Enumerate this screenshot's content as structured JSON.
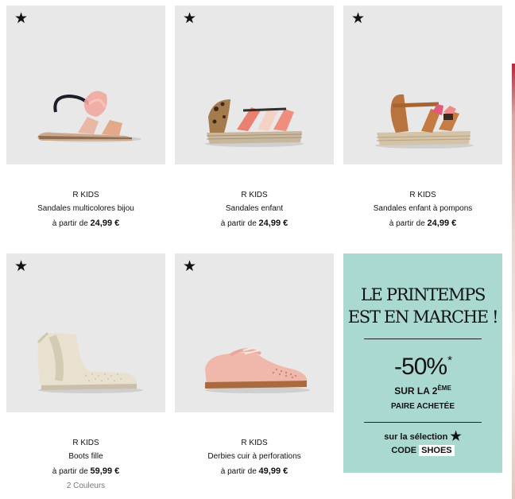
{
  "products": [
    {
      "brand": "R KIDS",
      "name": "Sandales multicolores bijou",
      "price_prefix": "à partir de",
      "price": "24,99 €",
      "fav_icon": "★"
    },
    {
      "brand": "R KIDS",
      "name": "Sandales enfant",
      "price_prefix": "à partir de",
      "price": "24,99 €",
      "fav_icon": "★"
    },
    {
      "brand": "R KIDS",
      "name": "Sandales enfant à pompons",
      "price_prefix": "à partir de",
      "price": "24,99 €",
      "fav_icon": "★"
    },
    {
      "brand": "R KIDS",
      "name": "Boots fille",
      "price_prefix": "à partir de",
      "price": "59,99 €",
      "colors": "2 Couleurs",
      "fav_icon": "★"
    },
    {
      "brand": "R KIDS",
      "name": "Derbies cuir à perforations",
      "price_prefix": "à partir de",
      "price": "49,99 €",
      "fav_icon": "★"
    }
  ],
  "promo": {
    "title_line1": "LE PRINTEMPS",
    "title_line2": "EST EN MARCHE !",
    "discount": "-50%",
    "discount_mark": "*",
    "line2_prefix": "SUR LA 2",
    "line2_sup": "ÈME",
    "line3": "PAIRE ACHETÉE",
    "selection": "sur la sélection",
    "selection_icon": "★",
    "code_label": "CODE",
    "code_value": "SHOES",
    "background_color": "#a9d9d0"
  }
}
